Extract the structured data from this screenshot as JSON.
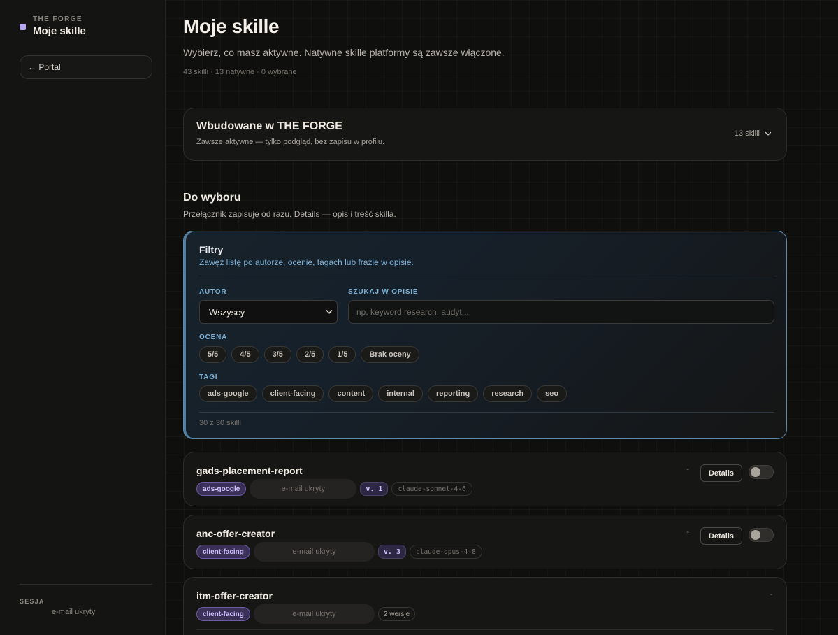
{
  "sidebar": {
    "kicker": "THE FORGE",
    "title": "Moje skille",
    "portal_label": "← Portal",
    "session_label": "SESJA",
    "session_value": "e-mail ukryty"
  },
  "header": {
    "title": "Moje skille",
    "subtitle": "Wybierz, co masz aktywne. Natywne skille platformy są zawsze włączone.",
    "meta": "43 skilli · 13 natywne · 0 wybrane"
  },
  "builtin": {
    "title": "Wbudowane w THE FORGE",
    "subtitle": "Zawsze aktywne — tylko podgląd, bez zapisu w profilu.",
    "count": "13 skilli"
  },
  "choice": {
    "title": "Do wyboru",
    "subtitle": "Przełącznik zapisuje od razu. Details — opis i treść skilla."
  },
  "filters": {
    "title": "Filtry",
    "subtitle": "Zawęź listę po autorze, ocenie, tagach lub frazie w opisie.",
    "author_label": "AUTOR",
    "author_value": "Wszyscy",
    "search_label": "SZUKAJ W OPISIE",
    "search_placeholder": "np. keyword research, audyt...",
    "rating_label": "OCENA",
    "ratings": [
      "5/5",
      "4/5",
      "3/5",
      "2/5",
      "1/5",
      "Brak oceny"
    ],
    "tags_label": "TAGI",
    "tags": [
      "ads-google",
      "client-facing",
      "content",
      "internal",
      "reporting",
      "research",
      "seo"
    ],
    "count": "30 z 30 skilli"
  },
  "skills": [
    {
      "name": "gads-placement-report",
      "tag": "ads-google",
      "author": "e-mail ukryty",
      "version": "v. 1",
      "model": "claude-sonnet-4-6",
      "rating": "-",
      "details_label": "Details"
    },
    {
      "name": "anc-offer-creator",
      "tag": "client-facing",
      "author": "e-mail ukryty",
      "version": "v. 3",
      "model": "claude-opus-4-8",
      "rating": "-",
      "details_label": "Details"
    },
    {
      "name": "itm-offer-creator",
      "tag": "client-facing",
      "author": "e-mail ukryty",
      "versions": "2 wersje",
      "rating": "-"
    }
  ],
  "colors": {
    "accent": "#b7a7ee",
    "filter_border": "#5f89aa",
    "filter_text": "#79b0d6",
    "tag_bg": "#3b3158"
  }
}
